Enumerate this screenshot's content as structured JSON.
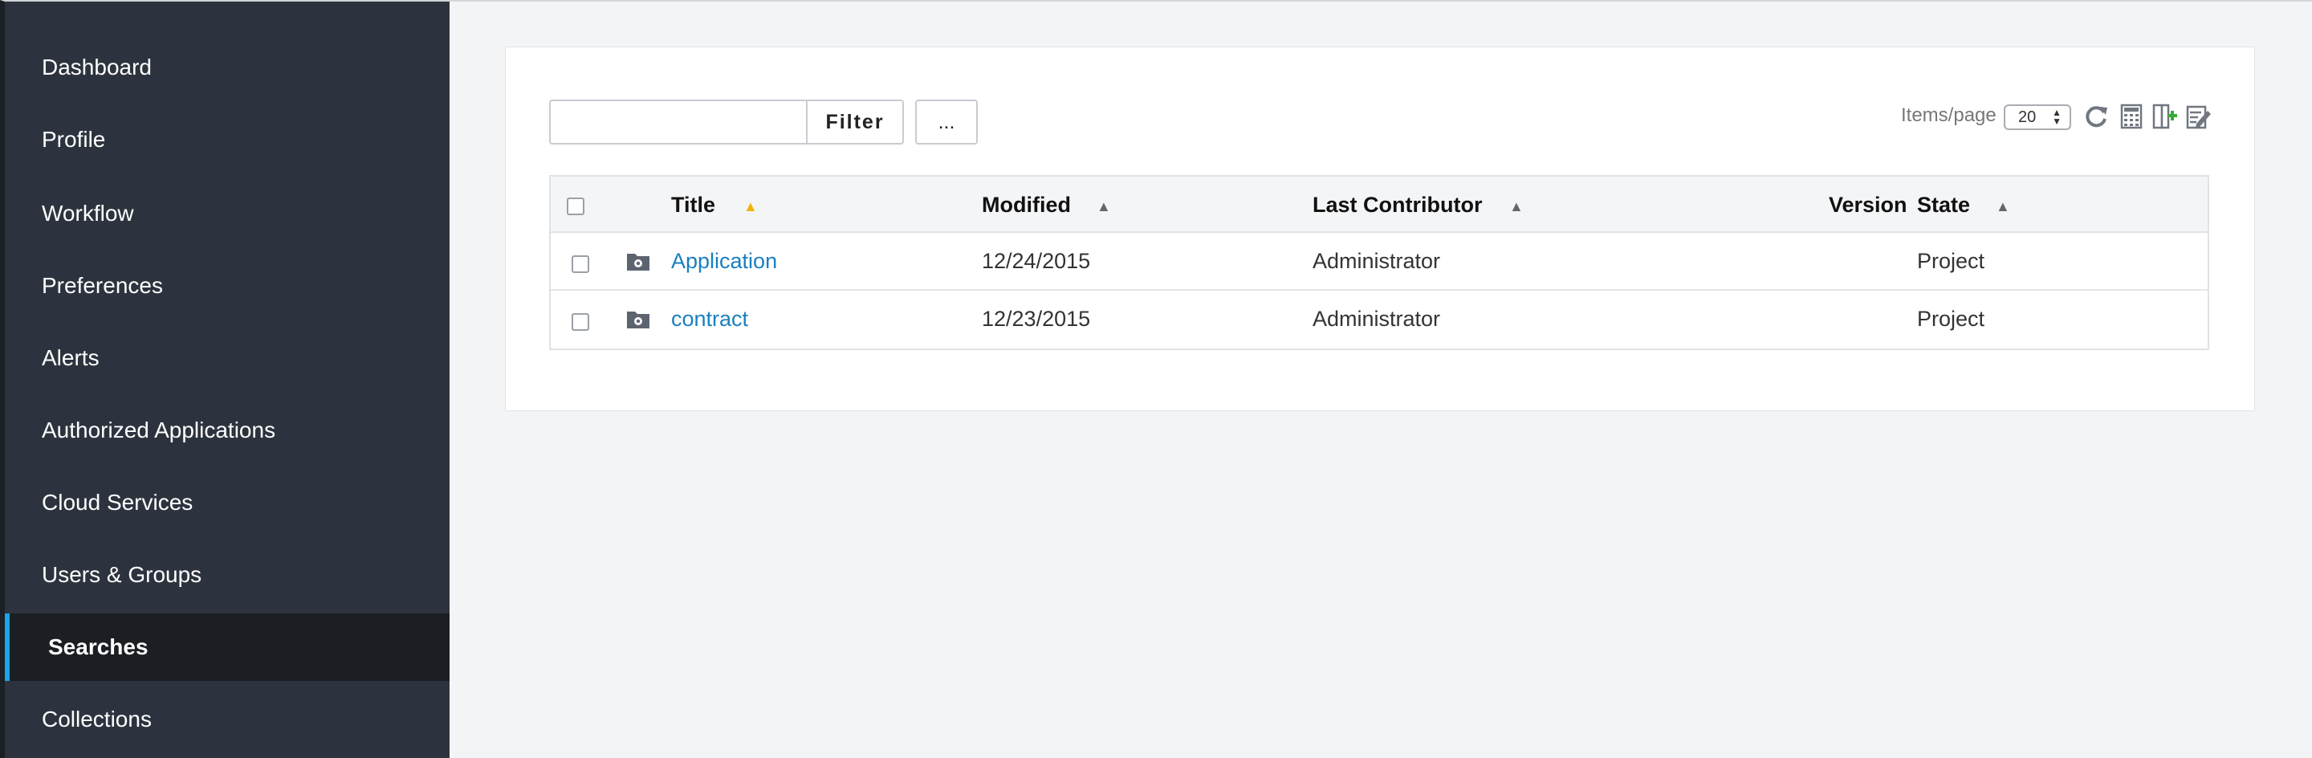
{
  "sidebar": {
    "items": [
      {
        "label": "Dashboard"
      },
      {
        "label": "Profile"
      },
      {
        "label": "Workflow"
      },
      {
        "label": "Preferences"
      },
      {
        "label": "Alerts"
      },
      {
        "label": "Authorized Applications"
      },
      {
        "label": "Cloud Services"
      },
      {
        "label": "Users & Groups"
      },
      {
        "label": "Searches",
        "active": true
      },
      {
        "label": "Collections"
      }
    ],
    "colors": {
      "background": "#2d333e",
      "active_background": "#1b1e23",
      "active_indicator": "#1aa6e8"
    }
  },
  "toolbar": {
    "filter_placeholder": "",
    "filter_label": "Filter",
    "more_label": "...",
    "items_per_page_label": "Items/page",
    "items_per_page_value": "20",
    "icons": [
      "refresh-icon",
      "spreadsheet-icon",
      "add-column-icon",
      "edit-columns-icon"
    ]
  },
  "table": {
    "columns": [
      "Title",
      "Modified",
      "Last Contributor",
      "Version",
      "State"
    ],
    "rows": [
      {
        "title": "Application",
        "modified": "12/24/2015",
        "contributor": "Administrator",
        "version": "",
        "state": "Project"
      },
      {
        "title": "contract",
        "modified": "12/23/2015",
        "contributor": "Administrator",
        "version": "",
        "state": "Project"
      }
    ],
    "colors": {
      "link": "#1a80c0",
      "sort_active": "#f0b400",
      "sort_inactive": "#666666"
    }
  }
}
